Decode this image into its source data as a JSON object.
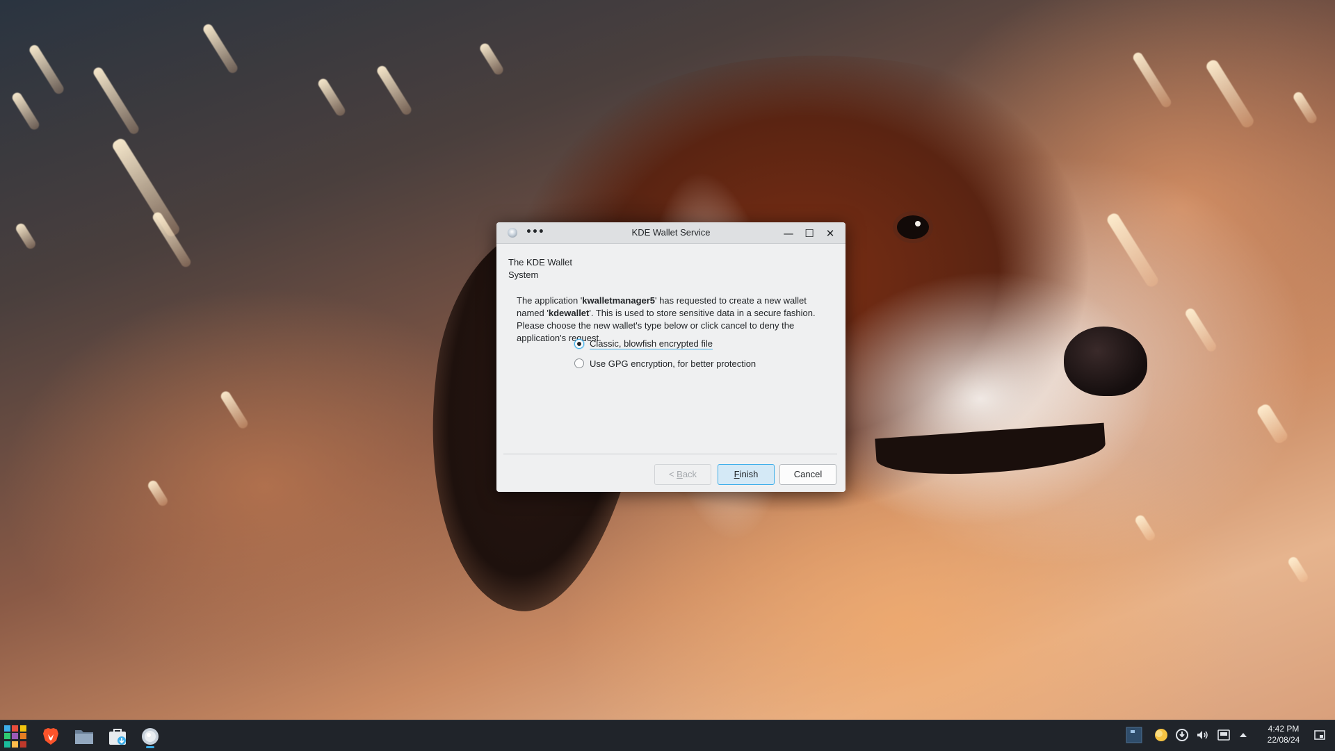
{
  "dialog": {
    "title": "KDE Wallet Service",
    "menu_glyph": "•••",
    "side_label_line1": "The KDE Wallet",
    "side_label_line2": "System",
    "message": {
      "part1": "The application '",
      "app_name": "kwalletmanager5",
      "part2": "' has requested to create a new wallet named '",
      "wallet_name": "kdewallet",
      "part3": "'. This is used to store sensitive data in a secure fashion. Please choose the new wallet's type below or click cancel to deny the application's request."
    },
    "options": [
      {
        "label": "Classic, blowfish encrypted file",
        "selected": true
      },
      {
        "label": "Use GPG encryption, for better protection",
        "selected": false
      }
    ],
    "buttons": {
      "back_prefix": "< ",
      "back_mnemonic": "B",
      "back_rest": "ack",
      "finish_mnemonic": "F",
      "finish_rest": "inish",
      "cancel": "Cancel"
    },
    "titlebar_buttons": {
      "minimize": "—",
      "maximize": "☐",
      "close": "✕"
    }
  },
  "taskbar": {
    "apps": [
      "application-launcher-icon",
      "brave-browser-icon",
      "file-manager-icon",
      "software-store-icon",
      "kde-wallet-icon"
    ],
    "tray": [
      "pager-icon",
      "night-color-icon",
      "updates-icon",
      "volume-icon",
      "network-icon",
      "expand-tray-icon",
      "show-desktop-icon"
    ],
    "clock": {
      "time": "4:42 PM",
      "date": "22/08/24"
    }
  },
  "colors": {
    "accent": "#3daee9",
    "dialog_bg": "#eff0f1",
    "taskbar_bg": "#20242a"
  }
}
